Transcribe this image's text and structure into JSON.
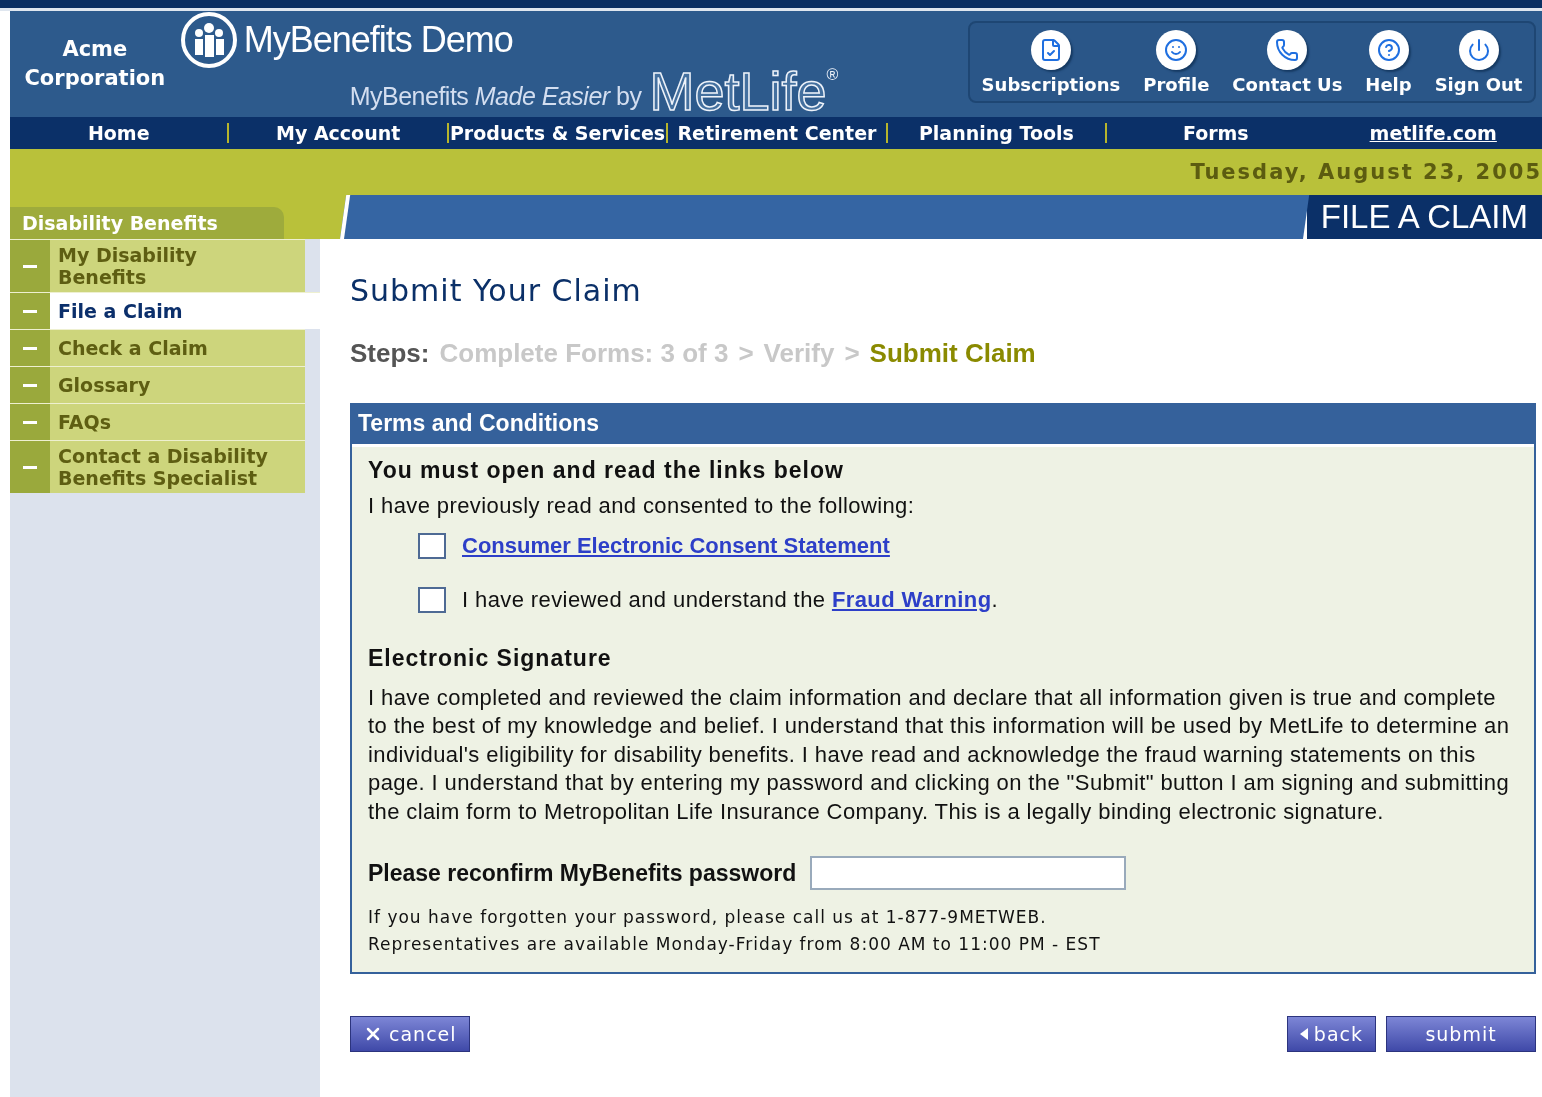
{
  "company": "Acme Corporation",
  "brand": {
    "title": "MyBenefits Demo",
    "tagline": "MyBenefits *Made Easier* by",
    "logo": "MetLife",
    "registered": "®"
  },
  "toolbar": [
    {
      "label": "Subscriptions",
      "kind": "subscriptions"
    },
    {
      "label": "Profile",
      "kind": "profile"
    },
    {
      "label": "Contact Us",
      "kind": "contact"
    },
    {
      "label": "Help",
      "kind": "help"
    },
    {
      "label": "Sign Out",
      "kind": "signout"
    }
  ],
  "nav": [
    {
      "label": "Home",
      "kind": "menu"
    },
    {
      "label": "My Account",
      "kind": "menu"
    },
    {
      "label": "Products & Services",
      "kind": "menu"
    },
    {
      "label": "Retirement Center",
      "kind": "menu"
    },
    {
      "label": "Planning Tools",
      "kind": "menu"
    },
    {
      "label": "Forms",
      "kind": "menu"
    },
    {
      "label": "metlife.com",
      "kind": "link"
    }
  ],
  "date": "Tuesday, August 23, 2005",
  "section_banner": "FILE A CLAIM",
  "sidebar": {
    "title": "Disability Benefits",
    "items": [
      {
        "label": "My Disability Benefits",
        "selected": false
      },
      {
        "label": "File a Claim",
        "selected": true
      },
      {
        "label": "Check a Claim",
        "selected": false
      },
      {
        "label": "Glossary",
        "selected": false
      },
      {
        "label": "FAQs",
        "selected": false
      },
      {
        "label": "Contact a Disability Benefits Specialist",
        "selected": false
      }
    ]
  },
  "page_title": "Submit Your Claim",
  "steps": {
    "label": "Steps:",
    "items": [
      {
        "label": "Complete Forms: 3 of 3",
        "separator": ">",
        "selected": false
      },
      {
        "label": "Verify",
        "separator": ">",
        "selected": false
      },
      {
        "label": "Submit Claim",
        "selected": true
      }
    ]
  },
  "terms": {
    "title": "Terms and Conditions",
    "instruction": "You must open and read the links below",
    "intro": "I have previously read and consented to the following:",
    "consents": [
      {
        "link": "Consumer Electronic Consent Statement",
        "checked": false
      },
      {
        "text_before": "I have reviewed and understand the",
        "link": "Fraud Warning",
        "text_after": ".",
        "checked": false
      }
    ],
    "signature_heading": "Electronic Signature",
    "signature_text": "I have completed and reviewed the claim information and declare that all information given is true and complete to the best of my knowledge and belief. I understand that this information will be used by MetLife to determine an individual's eligibility for disability benefits. I have read and acknowledge the fraud warning statements on this page. I understand that by entering my password and clicking on the \"Submit\" button I am signing and submitting the claim form to Metropolitan Life Insurance Company. This is a legally binding electronic signature.",
    "password_label": "Please reconfirm MyBenefits password",
    "help_lines": [
      "If you have forgotten your password, please call us at 1-877-9METWEB.",
      "Representatives are available Monday-Friday from 8:00 AM to 11:00 PM - EST"
    ]
  },
  "buttons": [
    {
      "label": "cancel",
      "kind": "cancel"
    },
    {
      "label": "back",
      "kind": "back"
    },
    {
      "label": "submit",
      "kind": "submit"
    }
  ]
}
